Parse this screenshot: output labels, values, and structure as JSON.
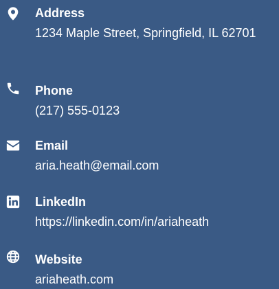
{
  "contact": {
    "items": [
      {
        "key": "address",
        "icon": "map-pin-icon",
        "label": "Address",
        "value": "1234 Maple Street, Springfield, IL 62701"
      },
      {
        "key": "phone",
        "icon": "phone-icon",
        "label": "Phone",
        "value": "(217) 555-0123"
      },
      {
        "key": "email",
        "icon": "envelope-icon",
        "label": "Email",
        "value": "aria.heath@email.com"
      },
      {
        "key": "linkedin",
        "icon": "linkedin-icon",
        "label": "LinkedIn",
        "value": "https://linkedin.com/in/ariaheath"
      },
      {
        "key": "website",
        "icon": "globe-icon",
        "label": "Website",
        "value": "ariaheath.com"
      }
    ]
  },
  "colors": {
    "background": "#3a5a85",
    "text": "#ffffff"
  }
}
